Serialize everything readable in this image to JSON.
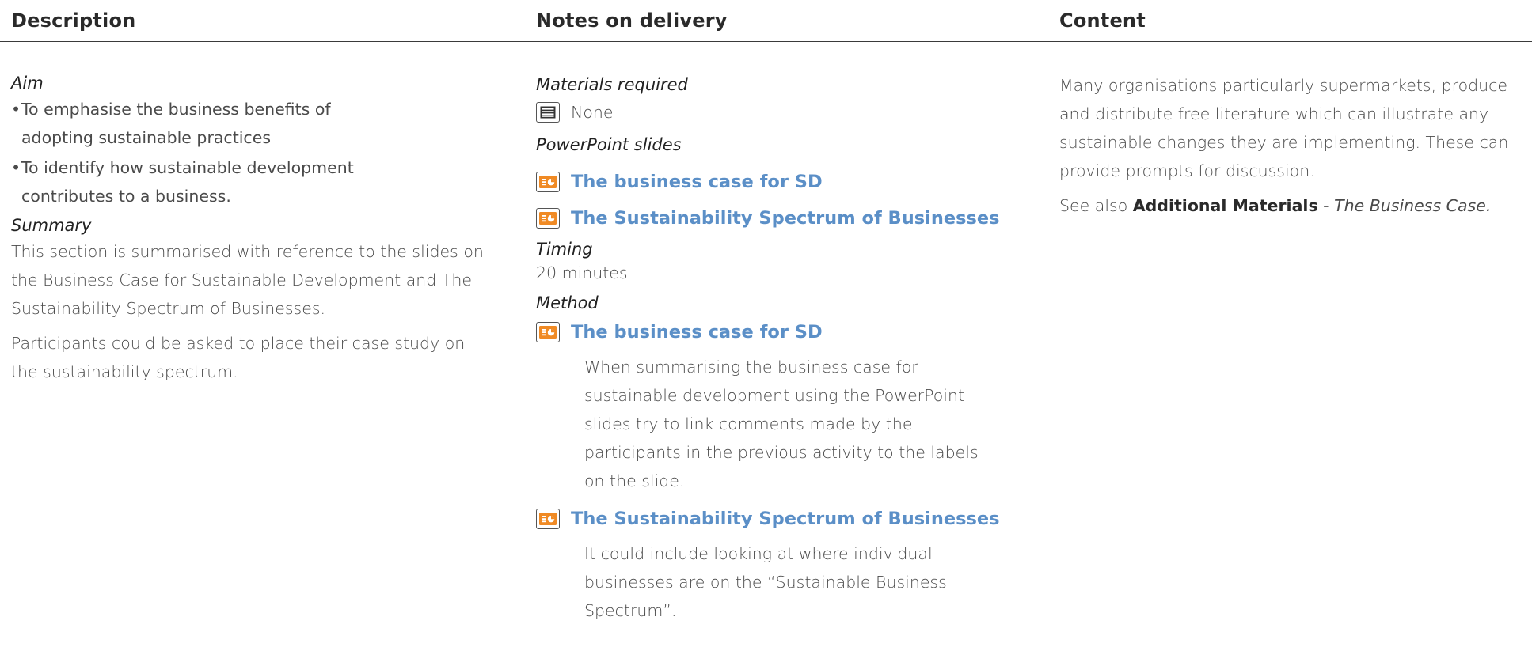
{
  "headers": {
    "description": "Description",
    "notes": "Notes on delivery",
    "content": "Content"
  },
  "description": {
    "aim_heading": "Aim",
    "aim_bullets": [
      "To emphasise the business benefits of adopting sustainable practices",
      "To identify how sustainable development contributes to a business."
    ],
    "summary_heading": "Summary",
    "summary_text": "This section is summarised with reference to the slides on the Business Case for Sustainable Development and The Sustainability Spectrum of Businesses.",
    "summary_text2": "Participants could be asked to place their case study on the sustainability spectrum."
  },
  "notes": {
    "materials_heading": "Materials required",
    "materials_value": "None",
    "materials_icon": "document-icon",
    "ppt_heading": "PowerPoint slides",
    "ppt_slides": [
      "The business case for SD",
      "The Sustainability Spectrum of Businesses"
    ],
    "timing_heading": "Timing",
    "timing_value": "20 minutes",
    "method_heading": "Method",
    "method_items": [
      {
        "slide": "The business case for SD",
        "text": "When summarising the business case for sustainable development using the PowerPoint slides try to link comments made by the participants in the previous activity to the labels on the slide."
      },
      {
        "slide": "The Sustainability Spectrum of Businesses",
        "text": "It could include looking at where individual businesses are on the “Sustainable Business Spectrum”."
      }
    ],
    "slide_icon": "powerpoint-slide-icon",
    "link_color": "#5b8fc7",
    "icon_color": "#f08a24"
  },
  "content": {
    "paragraph": "Many organisations particularly supermarkets, produce and distribute free literature which can illustrate any sustainable changes they are implementing. These can provide prompts for discussion.",
    "see_also_prefix": "See also ",
    "see_also_bold": "Additional Materials",
    "see_also_sep": " - ",
    "see_also_italic": "The Business Case."
  }
}
